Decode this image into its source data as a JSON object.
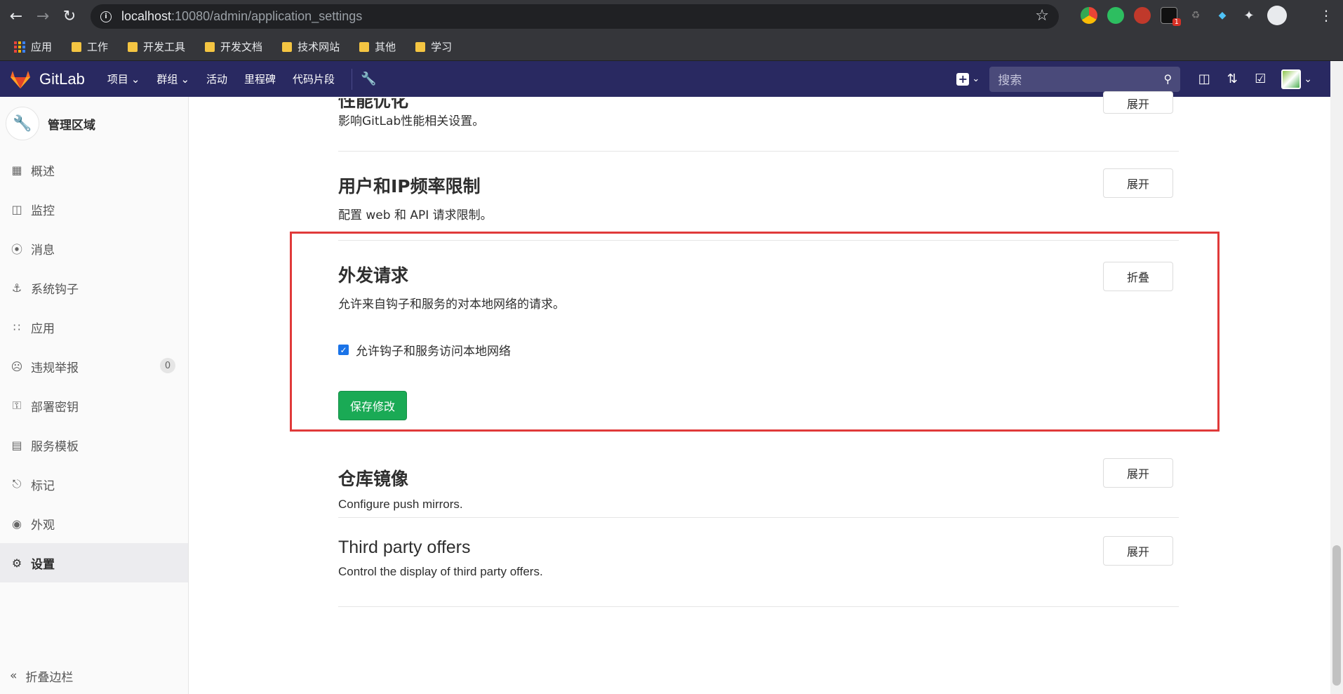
{
  "browser": {
    "url_host": "localhost",
    "url_path": ":10080/admin/application_settings",
    "extension_badge": "1",
    "bookmarks": [
      {
        "label": "应用",
        "icon": "apps-grid-icon"
      },
      {
        "label": "工作",
        "icon": "folder-icon"
      },
      {
        "label": "开发工具",
        "icon": "folder-icon"
      },
      {
        "label": "开发文档",
        "icon": "folder-icon"
      },
      {
        "label": "技术网站",
        "icon": "folder-icon"
      },
      {
        "label": "其他",
        "icon": "folder-icon"
      },
      {
        "label": "学习",
        "icon": "folder-icon"
      }
    ]
  },
  "gitlab_nav": {
    "logo_text": "GitLab",
    "menu": [
      {
        "label": "项目",
        "dropdown": true
      },
      {
        "label": "群组",
        "dropdown": true
      },
      {
        "label": "活动",
        "dropdown": false
      },
      {
        "label": "里程碑",
        "dropdown": false
      },
      {
        "label": "代码片段",
        "dropdown": false
      }
    ],
    "search_placeholder": "搜索"
  },
  "sidebar": {
    "title": "管理区域",
    "items": [
      {
        "label": "概述",
        "icon": "grid-icon",
        "active": false
      },
      {
        "label": "监控",
        "icon": "monitor-icon",
        "active": false
      },
      {
        "label": "消息",
        "icon": "broadcast-icon",
        "active": false
      },
      {
        "label": "系统钩子",
        "icon": "hook-icon",
        "active": false
      },
      {
        "label": "应用",
        "icon": "apps-icon",
        "active": false
      },
      {
        "label": "违规举报",
        "icon": "flag-face-icon",
        "active": false,
        "count": "0"
      },
      {
        "label": "部署密钥",
        "icon": "key-icon",
        "active": false
      },
      {
        "label": "服务模板",
        "icon": "template-icon",
        "active": false
      },
      {
        "label": "标记",
        "icon": "label-icon",
        "active": false
      },
      {
        "label": "外观",
        "icon": "palette-icon",
        "active": false
      },
      {
        "label": "设置",
        "icon": "gear-icon",
        "active": true
      }
    ],
    "collapse_label": "折叠边栏"
  },
  "main": {
    "sections": [
      {
        "title": "性能优化",
        "description": "影响GitLab性能相关设置。",
        "button": "展开"
      },
      {
        "title": "用户和IP频率限制",
        "description": "配置 web 和 API 请求限制。",
        "button": "展开"
      },
      {
        "title": "外发请求",
        "description": "允许来自钩子和服务的对本地网络的请求。",
        "button": "折叠",
        "checkbox_label": "允许钩子和服务访问本地网络",
        "checkbox_checked": true,
        "save_button": "保存修改"
      },
      {
        "title": "仓库镜像",
        "description": "Configure push mirrors.",
        "button": "展开"
      },
      {
        "title": "Third party offers",
        "description": "Control the display of third party offers.",
        "button": "展开"
      }
    ]
  },
  "colors": {
    "navbar": "#292961",
    "save_button": "#1aaa55",
    "highlight_border": "#e03a3a",
    "checkbox": "#1a73e8"
  }
}
